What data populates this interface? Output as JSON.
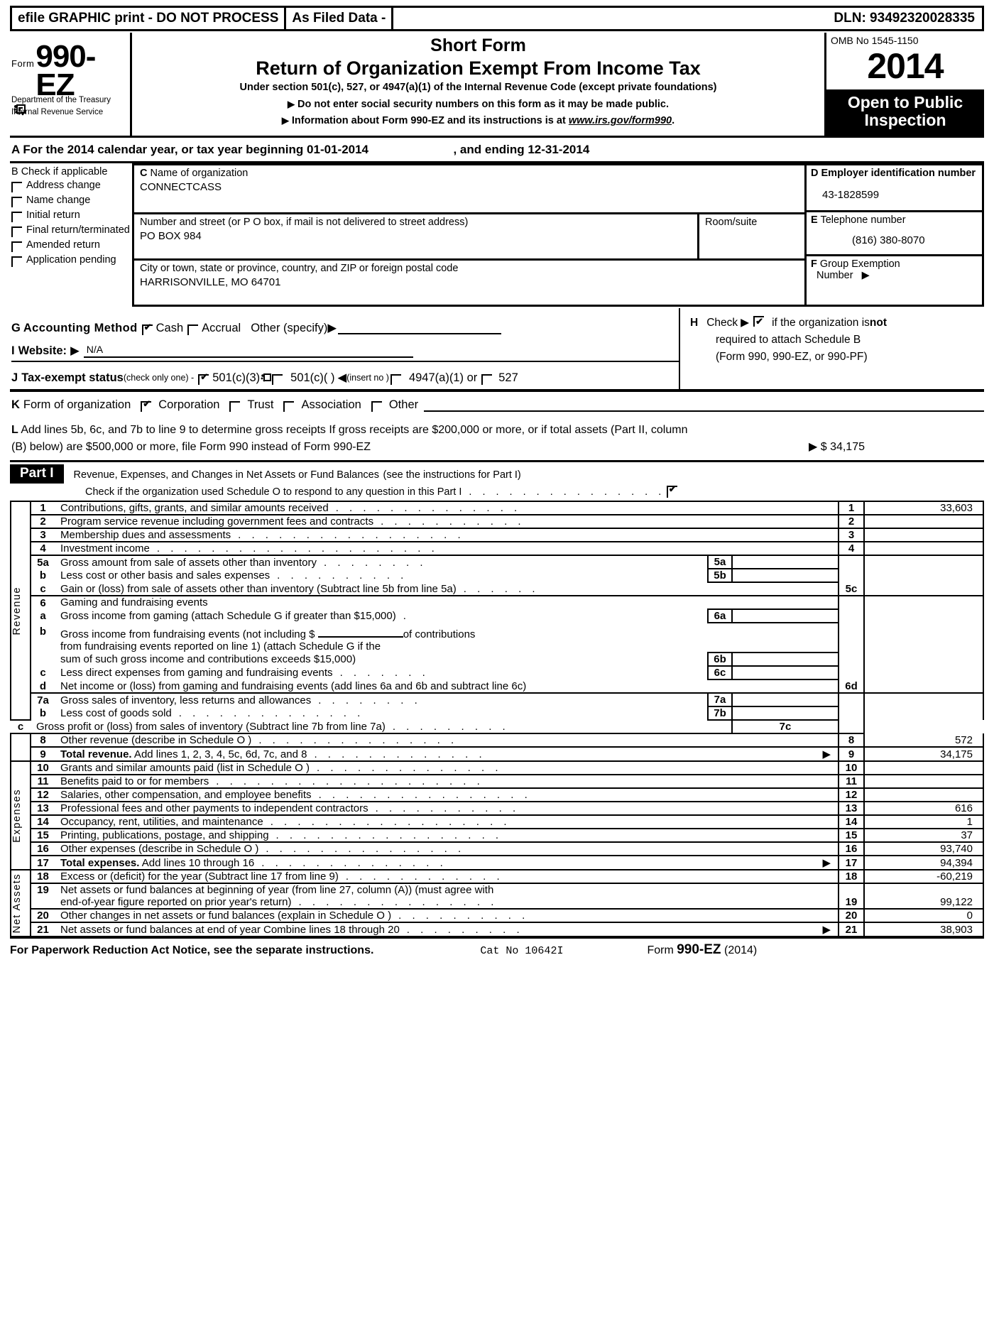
{
  "efile": {
    "graphic_print": "efile GRAPHIC print - DO NOT PROCESS",
    "as_filed": "As Filed Data -",
    "dln": "DLN: 93492320028335"
  },
  "header": {
    "form_word": "Form",
    "form_number": "990-EZ",
    "department_line1": "Department of the Treasury",
    "department_line2": "Internal Revenue Service",
    "short_form": "Short Form",
    "title": "Return of Organization Exempt From Income Tax",
    "under_section": "Under section 501(c), 527, or 4947(a)(1) of the Internal Revenue Code (except private foundations)",
    "bullet1": "Do not enter social security numbers on this form as it may be made public.",
    "bullet2_prefix": "Information about Form 990-EZ and its instructions is at ",
    "bullet2_link": "www.irs.gov/form990",
    "bullet2_suffix": ".",
    "omb": "OMB No 1545-1150",
    "year": "2014",
    "open_to_public": "Open to Public Inspection"
  },
  "line_a": {
    "label": "A  For the 2014 calendar year, or tax year beginning",
    "begin_date": "01-01-2014",
    "and_ending": ", and ending",
    "end_date": "12-31-2014"
  },
  "section_b": {
    "letter": "B",
    "title": "Check if applicable",
    "items": [
      {
        "label": "Address change",
        "checked": false
      },
      {
        "label": "Name change",
        "checked": false
      },
      {
        "label": "Initial return",
        "checked": false
      },
      {
        "label": "Final return/terminated",
        "checked": false
      },
      {
        "label": "Amended return",
        "checked": false
      },
      {
        "label": "Application pending",
        "checked": false
      }
    ]
  },
  "section_c": {
    "name_label_letter": "C",
    "name_label": "Name of organization",
    "name_value": "CONNECTCASS",
    "street_label": "Number and street (or P  O  box, if mail is not delivered to street address)",
    "street_value": "PO BOX 984",
    "room_label": "Room/suite",
    "room_value": "",
    "city_label": "City or town, state or province, country, and ZIP or foreign postal code",
    "city_value": "HARRISONVILLE, MO  64701"
  },
  "section_d": {
    "ein_letter": "D",
    "ein_label": "Employer identification number",
    "ein_value": "43-1828599",
    "phone_letter": "E",
    "phone_label": "Telephone number",
    "phone_value": "(816) 380-8070",
    "group_letter": "F",
    "group_label": "Group Exemption",
    "group_sub": "Number",
    "group_value": ""
  },
  "section_g": {
    "letter": "G",
    "label": "Accounting Method",
    "cash": "Cash",
    "cash_checked": true,
    "accrual": "Accrual",
    "accrual_checked": false,
    "other": "Other (specify)",
    "other_value": ""
  },
  "section_i": {
    "letter": "I",
    "label": "Website:",
    "value": "N/A"
  },
  "section_j": {
    "letter": "J",
    "label": "Tax-exempt status",
    "note": "(check only one) -",
    "opt1": "501(c)(3)",
    "opt1_checked": true,
    "opt2": "501(c)(   )",
    "opt2_checked": false,
    "insert": "(insert no )",
    "opt3": "4947(a)(1) or",
    "opt3_checked": false,
    "opt4": "527",
    "opt4_checked": false
  },
  "section_k": {
    "letter": "K",
    "label": "Form of organization",
    "opt1": "Corporation",
    "opt1_checked": true,
    "opt2": "Trust",
    "opt2_checked": false,
    "opt3": "Association",
    "opt3_checked": false,
    "opt4": "Other",
    "opt4_checked": false,
    "other_value": ""
  },
  "section_h": {
    "letter": "H",
    "check_word": "Check",
    "text1_pre": "if the organization is ",
    "text1_bold": "not",
    "text2": "required to attach Schedule B",
    "text3": "(Form 990, 990-EZ, or 990-PF)",
    "checked": true
  },
  "section_l": {
    "letter": "L",
    "line1": "Add lines 5b, 6c, and 7b to line 9 to determine gross receipts  If gross receipts are $200,000 or more, or if total assets (Part II, column",
    "line2": "(B) below) are $500,000 or more, file Form 990 instead of Form 990-EZ",
    "amount": "$ 34,175"
  },
  "part1": {
    "tag": "Part I",
    "title": "Revenue, Expenses, and Changes in Net Assets or Fund Balances",
    "title_note": "(see the instructions for Part I)",
    "schedule_o_text": "Check if the organization used Schedule O to respond to any question in this Part I",
    "schedule_o_checked": true,
    "side_labels": {
      "revenue": "Revenue",
      "expenses": "Expenses",
      "net_assets": "Net Assets"
    }
  },
  "lines": [
    {
      "no": "1",
      "text": "Contributions, gifts, grants, and similar amounts received",
      "box": "1",
      "amount": "33,603",
      "bold": false
    },
    {
      "no": "2",
      "text": "Program service revenue including government fees and contracts",
      "box": "2",
      "amount": "",
      "bold": false
    },
    {
      "no": "3",
      "text": "Membership dues and assessments",
      "box": "3",
      "amount": "",
      "bold": false
    },
    {
      "no": "4",
      "text": "Investment income",
      "box": "4",
      "amount": "",
      "bold": false
    },
    {
      "no": "5a",
      "text": "Gross amount from sale of assets other than inventory",
      "inline_box": "5a",
      "inline_amount": "",
      "bold": false
    },
    {
      "no": "b",
      "text": "Less  cost or other basis and sales expenses",
      "inline_box": "5b",
      "inline_amount": "",
      "bold": false
    },
    {
      "no": "c",
      "text": "Gain or (loss) from sale of assets other than inventory (Subtract line 5b from line 5a)",
      "box": "5c",
      "amount": "",
      "bold": false
    },
    {
      "no": "6",
      "text": "Gaming and fundraising events",
      "box": "",
      "amount": "",
      "bold": false
    },
    {
      "no": "a",
      "text": "Gross income from gaming (attach Schedule G if greater than $15,000)",
      "inline_box": "6a",
      "inline_amount": "",
      "bold": false
    },
    {
      "no": "b",
      "text": "Gross income from fundraising events (not including $ ______ of contributions",
      "inline_box": "",
      "inline_amount": "",
      "bold": false
    },
    {
      "no": "",
      "text": "from fundraising events reported on line 1) (attach Schedule G if the",
      "inline_box": "",
      "inline_amount": "",
      "bold": false
    },
    {
      "no": "",
      "text": "sum of such gross income and contributions exceeds $15,000)",
      "inline_box": "6b",
      "inline_amount": "",
      "bold": false
    },
    {
      "no": "c",
      "text": "Less  direct expenses from gaming and fundraising events",
      "inline_box": "6c",
      "inline_amount": "",
      "bold": false
    },
    {
      "no": "d",
      "text": "Net income or (loss) from gaming and fundraising events (add lines 6a and 6b and subtract line 6c)",
      "box": "6d",
      "amount": "",
      "bold": false
    },
    {
      "no": "7a",
      "text": "Gross sales of inventory, less returns and allowances",
      "inline_box": "7a",
      "inline_amount": "",
      "bold": false
    },
    {
      "no": "b",
      "text": "Less  cost of goods sold",
      "inline_box": "7b",
      "inline_amount": "",
      "bold": false
    },
    {
      "no": "c",
      "text": "Gross profit or (loss) from sales of inventory (Subtract line 7b from line 7a)",
      "box": "7c",
      "amount": "",
      "bold": false
    },
    {
      "no": "8",
      "text": "Other revenue (describe in Schedule O )",
      "box": "8",
      "amount": "572",
      "bold": false
    },
    {
      "no": "9",
      "text": "Total revenue.",
      "text2": " Add lines 1, 2, 3, 4, 5c, 6d, 7c, and 8",
      "box": "9",
      "amount": "34,175",
      "bold": true
    },
    {
      "no": "10",
      "text": "Grants and similar amounts paid (list in Schedule O )",
      "box": "10",
      "amount": "",
      "bold": false
    },
    {
      "no": "11",
      "text": "Benefits paid to or for members",
      "box": "11",
      "amount": "",
      "bold": false
    },
    {
      "no": "12",
      "text": "Salaries, other compensation, and employee benefits",
      "box": "12",
      "amount": "",
      "bold": false
    },
    {
      "no": "13",
      "text": "Professional fees and other payments to independent contractors",
      "box": "13",
      "amount": "616",
      "bold": false
    },
    {
      "no": "14",
      "text": "Occupancy, rent, utilities, and maintenance",
      "box": "14",
      "amount": "1",
      "bold": false
    },
    {
      "no": "15",
      "text": "Printing, publications, postage, and shipping",
      "box": "15",
      "amount": "37",
      "bold": false
    },
    {
      "no": "16",
      "text": "Other expenses (describe in Schedule O )",
      "box": "16",
      "amount": "93,740",
      "bold": false
    },
    {
      "no": "17",
      "text": "Total expenses.",
      "text2": " Add lines 10 through 16",
      "box": "17",
      "amount": "94,394",
      "bold": true
    },
    {
      "no": "18",
      "text": "Excess or (deficit) for the year (Subtract line 17 from line 9)",
      "box": "18",
      "amount": "-60,219",
      "bold": false
    },
    {
      "no": "19",
      "text": "Net assets or fund balances at beginning of year (from line 27, column (A)) (must agree with",
      "box": "",
      "amount": "",
      "bold": false
    },
    {
      "no": "",
      "text": "end-of-year figure reported on prior year's return)",
      "box": "19",
      "amount": "99,122",
      "bold": false
    },
    {
      "no": "20",
      "text": "Other changes in net assets or fund balances (explain in Schedule O )",
      "box": "20",
      "amount": "0",
      "bold": false
    },
    {
      "no": "21",
      "text": "Net assets or fund balances at end of year  Combine lines 18 through 20",
      "box": "21",
      "amount": "38,903",
      "bold": false
    }
  ],
  "footer": {
    "left": "For Paperwork Reduction Act Notice, see the separate instructions.",
    "cat": "Cat No 10642I",
    "form_word": "Form",
    "form_number": "990-EZ",
    "year": "(2014)"
  },
  "colors": {
    "ink": "#000000",
    "paper": "#ffffff"
  }
}
